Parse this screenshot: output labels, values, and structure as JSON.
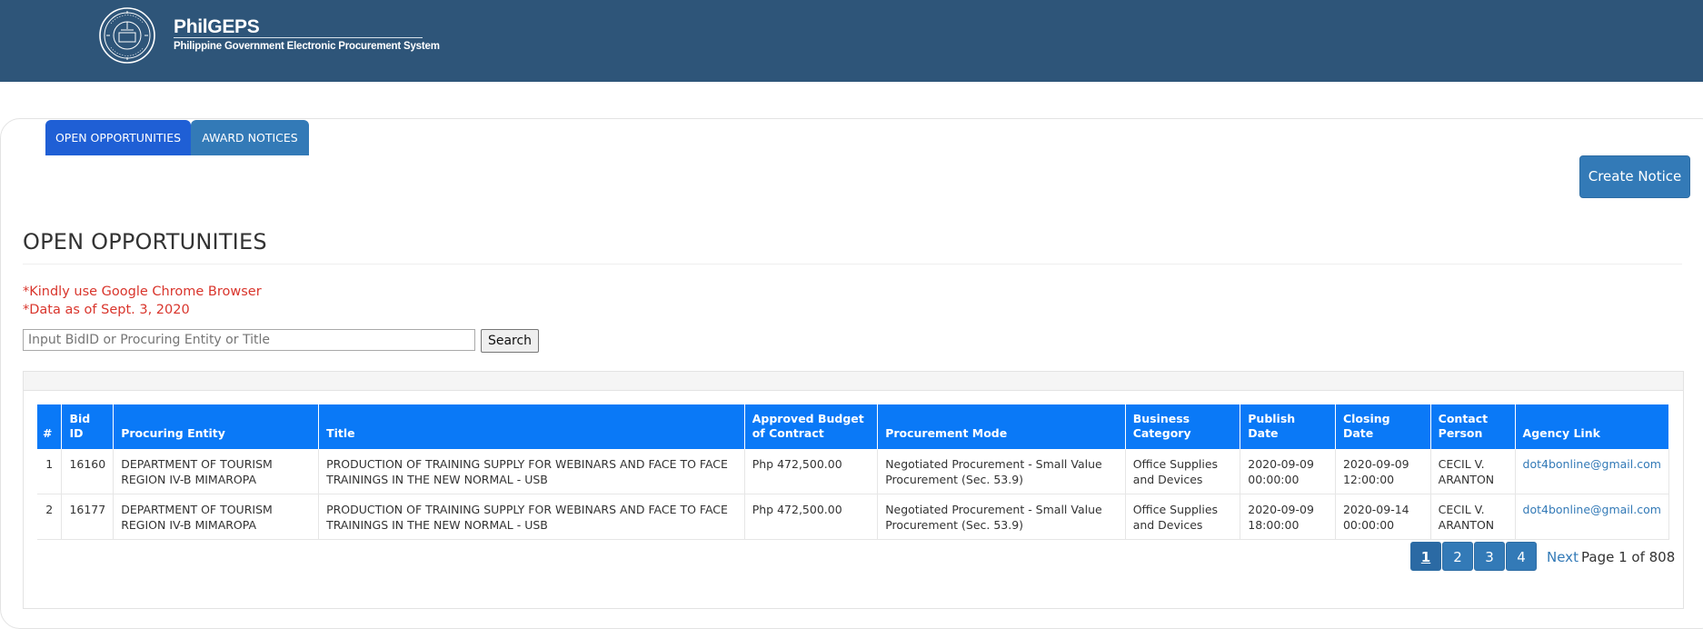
{
  "header": {
    "brand_name": "PhilGEPS",
    "brand_subtitle": "Philippine Government Electronic Procurement System",
    "logo_icon": "philgeps-seal-icon",
    "background_color": "#2e5579"
  },
  "tabs": [
    {
      "label": "OPEN OPPORTUNITIES",
      "active": true
    },
    {
      "label": "AWARD NOTICES",
      "active": false
    }
  ],
  "actions": {
    "create_notice_label": "Create Notice"
  },
  "page_title": "OPEN OPPORTUNITIES",
  "notices": [
    "*Kindly use Google Chrome Browser",
    "*Data as of Sept. 3, 2020"
  ],
  "search": {
    "placeholder": "Input BidID or Procuring Entity or Title",
    "value": "",
    "button_label": "Search"
  },
  "table": {
    "headers": {
      "num": "#",
      "bid_id": "Bid ID",
      "entity": "Procuring Entity",
      "title": "Title",
      "budget": "Approved Budget of Contract",
      "mode": "Procurement Mode",
      "category": "Business Category",
      "publish": "Publish Date",
      "closing": "Closing Date",
      "contact": "Contact Person",
      "link": "Agency Link"
    },
    "rows": [
      {
        "num": "1",
        "bid_id": "16160",
        "entity": "DEPARTMENT OF TOURISM REGION IV-B MIMAROPA",
        "title": "PRODUCTION OF TRAINING SUPPLY FOR WEBINARS AND FACE TO FACE TRAININGS IN THE NEW NORMAL - USB",
        "budget": "Php 472,500.00",
        "mode": "Negotiated Procurement - Small Value Procurement (Sec. 53.9)",
        "category": "Office Supplies and Devices",
        "publish": "2020-09-09 00:00:00",
        "closing": "2020-09-09 12:00:00",
        "contact": "CECIL V. ARANTON",
        "link": "dot4bonline@gmail.com"
      },
      {
        "num": "2",
        "bid_id": "16177",
        "entity": "DEPARTMENT OF TOURISM REGION IV-B MIMAROPA",
        "title": "PRODUCTION OF TRAINING SUPPLY FOR WEBINARS AND FACE TO FACE TRAININGS IN THE NEW NORMAL - USB",
        "budget": "Php 472,500.00",
        "mode": "Negotiated Procurement - Small Value Procurement (Sec. 53.9)",
        "category": "Office Supplies and Devices",
        "publish": "2020-09-09 18:00:00",
        "closing": "2020-09-14 00:00:00",
        "contact": "CECIL V. ARANTON",
        "link": "dot4bonline@gmail.com"
      }
    ]
  },
  "pagination": {
    "pages": [
      "1",
      "2",
      "3",
      "4"
    ],
    "current": "1",
    "next_label": "Next",
    "page_info": "Page 1 of 808"
  },
  "colors": {
    "header_table": "#0a79f7",
    "button_primary": "#337ab7",
    "notice_red": "#d9352c",
    "tab_active": "#1f5fd5"
  }
}
